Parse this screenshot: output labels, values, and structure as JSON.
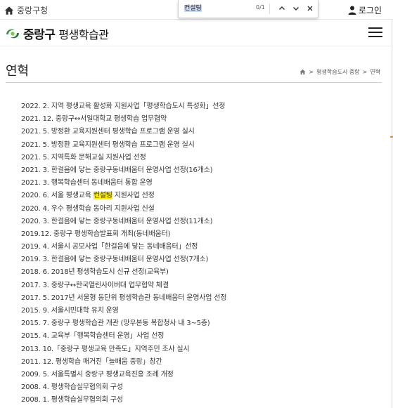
{
  "topbar": {
    "home_label": "중랑구청",
    "login_label": "로그인"
  },
  "find": {
    "query": "컨설팅",
    "count": "0/1"
  },
  "header": {
    "logo_main": "중랑구",
    "logo_sub": "평생학습관"
  },
  "page": {
    "title": "연혁",
    "breadcrumb": [
      "평생학습도시 중랑",
      "연혁"
    ]
  },
  "timeline": [
    {
      "before": "2022. 2. 지역 평생교육 활성화 지원사업「평생학습도시 특성화」선정",
      "hl": "",
      "after": ""
    },
    {
      "before": "2021. 12. 중랑구↔서일대학교 평생학습 업무협약",
      "hl": "",
      "after": ""
    },
    {
      "before": "2021. 5. 방정환 교육지원센터 평생학습 프로그램 운영 실시",
      "hl": "",
      "after": ""
    },
    {
      "before": "2021. 5. 방정환 교육지원센터 평생학습 프로그램 운영 실시",
      "hl": "",
      "after": ""
    },
    {
      "before": "2021. 5. 지역특화 문해교실 지원사업 선정",
      "hl": "",
      "after": ""
    },
    {
      "before": "2021. 3. 한걸음에 닿는 중랑구동네배움터 운영사업 선정(16개소)",
      "hl": "",
      "after": ""
    },
    {
      "before": "2021. 3. 행복학습센터 동네배움터 통합 운영",
      "hl": "",
      "after": ""
    },
    {
      "before": "2020. 6. 서울 평생교육 ",
      "hl": "컨설팅",
      "after": " 지원사업 선정"
    },
    {
      "before": "2020. 4. 우수 평생학습 동아리 지원사업 신설",
      "hl": "",
      "after": ""
    },
    {
      "before": "2020. 3. 한걸음에 닿는 중랑구동네배움터 운영사업 선정(11개소)",
      "hl": "",
      "after": ""
    },
    {
      "before": "2019.12. 중랑구 평생학습발표회 개최(동네배움터)",
      "hl": "",
      "after": ""
    },
    {
      "before": "2019. 4. 서울시 공모사업「한걸음에 닿는 동네배움터」선정",
      "hl": "",
      "after": ""
    },
    {
      "before": "2019. 3. 한걸음에 닿는 중랑구동네배움터 운영사업 선정(7개소)",
      "hl": "",
      "after": ""
    },
    {
      "before": "2018. 6. 2018년 평생학습도시 신규 선정(교육부)",
      "hl": "",
      "after": ""
    },
    {
      "before": "2017. 3. 중랑구↔한국열린사이버대 업무협약 체결",
      "hl": "",
      "after": ""
    },
    {
      "before": "2017. 5. 2017년 서울형 동단위 평생학습관 동네배움터 운영사업 선정",
      "hl": "",
      "after": ""
    },
    {
      "before": "2015. 9. 서울시민대학 유치 운영",
      "hl": "",
      "after": ""
    },
    {
      "before": "2015. 7. 중랑구 평생학습관 개관 (망우본동 복합청사 내 3~5층)",
      "hl": "",
      "after": ""
    },
    {
      "before": "2015. 4. 교육부「행복학습센터 운영」사업 선정",
      "hl": "",
      "after": ""
    },
    {
      "before": "2013. 10.「중랑구 평생교육 만족도」지역주민 조사 실시",
      "hl": "",
      "after": ""
    },
    {
      "before": "2011. 12. 평생학습 매거진「늘배움 중랑」창간",
      "hl": "",
      "after": ""
    },
    {
      "before": "2009. 5. 서울특별시 중랑구 평생교육진흥 조례 개정",
      "hl": "",
      "after": ""
    },
    {
      "before": "2008. 4. 평생학습실무협의회 구성",
      "hl": "",
      "after": ""
    },
    {
      "before": "2008. 1. 평생학습실무협의회 구성",
      "hl": "",
      "after": ""
    }
  ]
}
